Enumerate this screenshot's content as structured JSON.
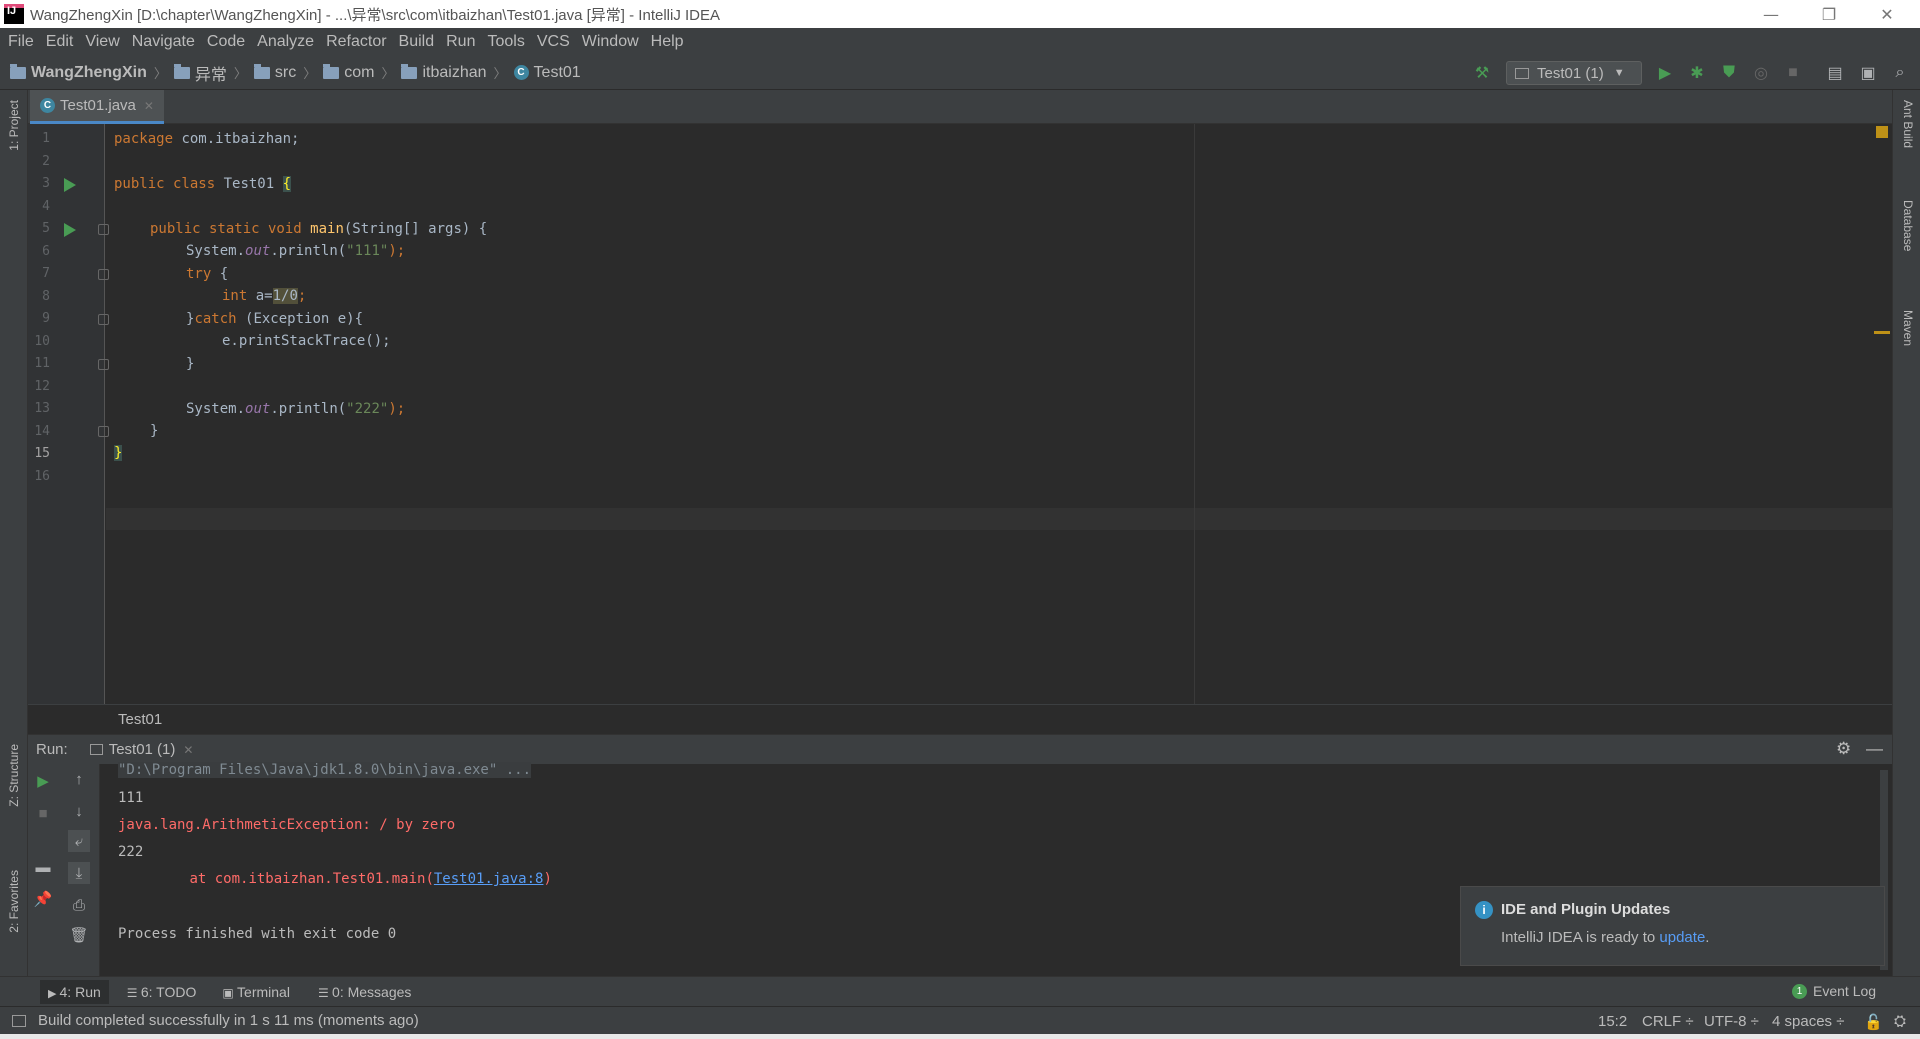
{
  "window": {
    "title": "WangZhengXin [D:\\chapter\\WangZhengXin] - ...\\异常\\src\\com\\itbaizhan\\Test01.java [异常] - IntelliJ IDEA"
  },
  "menu": [
    "File",
    "Edit",
    "View",
    "Navigate",
    "Code",
    "Analyze",
    "Refactor",
    "Build",
    "Run",
    "Tools",
    "VCS",
    "Window",
    "Help"
  ],
  "breadcrumb": {
    "project": "WangZhengXin",
    "module": "异常",
    "src": "src",
    "pkg1": "com",
    "pkg2": "itbaizhan",
    "cls": "Test01"
  },
  "run_config": "Test01 (1)",
  "editor_tab": "Test01.java",
  "left_tools": {
    "project": "1: Project",
    "structure": "Z: Structure",
    "favorites": "2: Favorites"
  },
  "right_tools": {
    "ant": "Ant Build",
    "database": "Database",
    "maven": "Maven"
  },
  "code": {
    "l1a": "package",
    "l1b": " com.itbaizhan;",
    "l3a": "public class",
    "l3b": " Test01 ",
    "l3c": "{",
    "l5a": "public static void",
    "l5b": "main",
    "l5c": "(String[] args) {",
    "sys": "System.",
    "out": "out",
    "println": ".println(",
    "s111": "\"111\"",
    "end": ");",
    "try": "try",
    "tryb": " {",
    "int": "int",
    "var": " a=",
    "expr": "1/0",
    "semi": ";",
    "catch1": "}",
    "catch2": "catch",
    "catch3": " (Exception e){",
    "trace": "e.printStackTrace();",
    "close": "}",
    "s222": "\"222\"",
    "close2": "}",
    "close3": "}"
  },
  "line_numbers": [
    "1",
    "2",
    "3",
    "4",
    "5",
    "6",
    "7",
    "8",
    "9",
    "10",
    "11",
    "12",
    "13",
    "14",
    "15",
    "16"
  ],
  "editor_footer": "Test01",
  "run_panel": {
    "label": "Run:",
    "tab": "Test01 (1)",
    "output": {
      "cmd": "\"D:\\Program Files\\Java\\jdk1.8.0\\bin\\java.exe\" ...",
      "o1": "111",
      "err": "java.lang.ArithmeticException: / by zero",
      "o2": "222",
      "at": "\tat com.itbaizhan.Test01.main(",
      "link": "Test01.java:8",
      "atend": ")",
      "exit": "Process finished with exit code 0"
    }
  },
  "notification": {
    "title": "IDE and Plugin Updates",
    "text": "IntelliJ IDEA is ready to ",
    "link": "update",
    "dot": "."
  },
  "bottom_tabs": {
    "run": "4: Run",
    "todo": "6: TODO",
    "terminal": "Terminal",
    "messages": "0: Messages",
    "eventlog": "Event Log",
    "eventcount": "1"
  },
  "status": {
    "message": "Build completed successfully in 1 s 11 ms (moments ago)",
    "position": "15:2",
    "line_sep": "CRLF ÷",
    "encoding": "UTF-8 ÷",
    "indent": "4 spaces ÷"
  },
  "colors": {
    "accent": "#4a88c7",
    "run_green": "#499c54",
    "error_red": "#ff6b68",
    "link": "#589df6"
  }
}
